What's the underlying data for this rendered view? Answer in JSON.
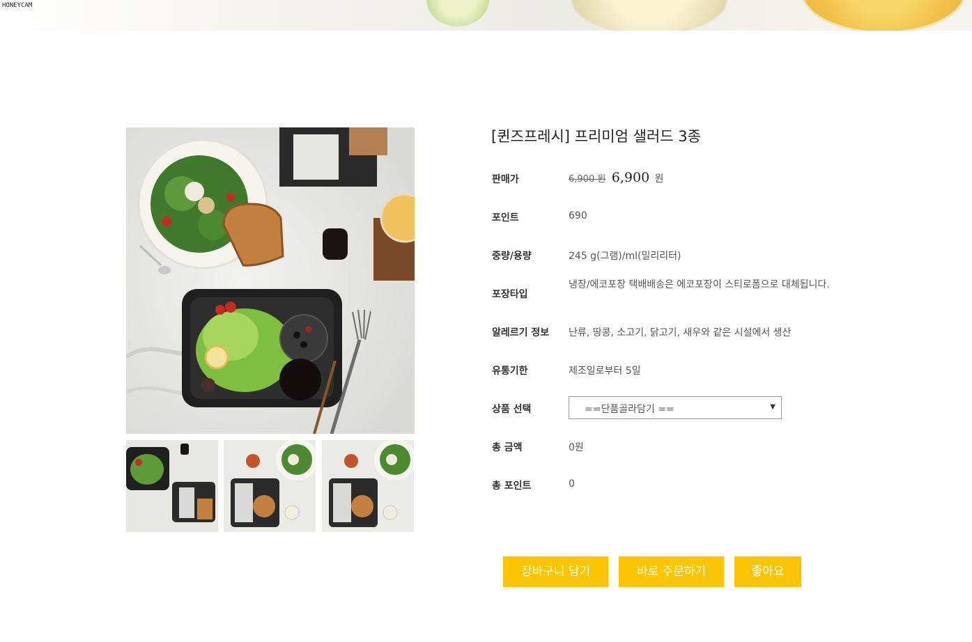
{
  "watermark": "HONEYCAM",
  "product": {
    "title": "[퀸즈프레시] 프리미엄 샐러드 3종",
    "rows": {
      "price": {
        "label": "판매가",
        "original": "6,900 원",
        "sale": "6,900",
        "unit": "원"
      },
      "point": {
        "label": "포인트",
        "value": "690"
      },
      "weight": {
        "label": "중량/용량",
        "value": "245 g(그램)/ml(밀리리터)"
      },
      "package": {
        "label": "포장타입",
        "value": "냉장/에코포장 택배배송은 에코포장이 스티로폼으로 대체됩니다."
      },
      "allergy": {
        "label": "알레르기 정보",
        "value": "난류, 땅콩, 소고기, 닭고기, 새우와 같은 시설에서 생산"
      },
      "expiry": {
        "label": "유통기한",
        "value": "제조일로부터 5일"
      },
      "option": {
        "label": "상품 선택",
        "selected": "==단품골라담기 =="
      },
      "total": {
        "label": "총 금액",
        "value": "0원"
      },
      "total_point": {
        "label": "총 포인트",
        "value": "0"
      }
    }
  },
  "buttons": {
    "cart": "장바구니 담기",
    "order": "바로 주문하기",
    "like": "좋아요"
  },
  "colors": {
    "button": "#fbc600",
    "button_text": "#ffffff"
  }
}
